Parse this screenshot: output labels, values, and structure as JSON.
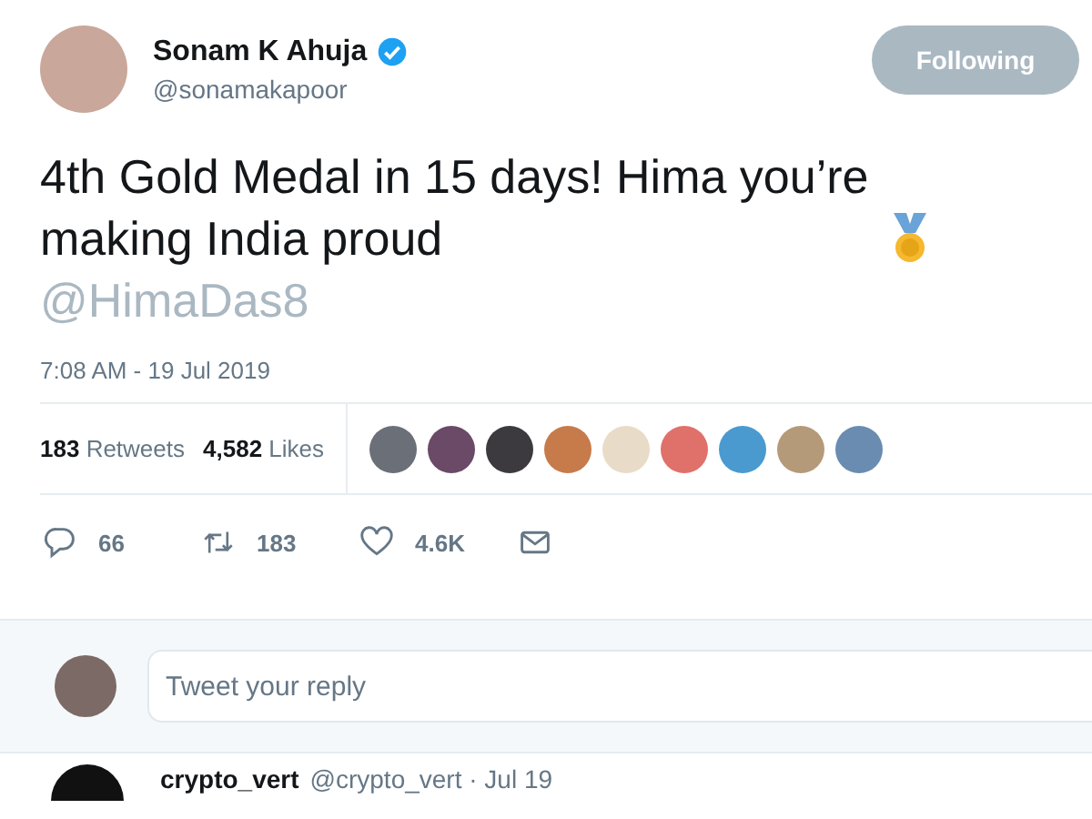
{
  "author": {
    "name": "Sonam K Ahuja",
    "verified": true,
    "handle": "@sonamakapoor"
  },
  "follow_button": {
    "label": "Following",
    "selected": true
  },
  "tweet": {
    "text": "4th Gold Medal in 15 days! Hima you’re making India proud",
    "mention": "@HimaDas8",
    "timestamp": "7:08 AM - 19 Jul 2019"
  },
  "stats": [
    {
      "count": "183",
      "label": "Retweets"
    },
    {
      "count": "4,582",
      "label": "Likes"
    }
  ],
  "liked_by": [
    {
      "color": "#6b6f78"
    },
    {
      "color": "#6a4a66"
    },
    {
      "color": "#3c3a3e"
    },
    {
      "color": "#c77a4a"
    },
    {
      "color": "#e8dcc8"
    },
    {
      "color": "#e0706a"
    },
    {
      "color": "#4a9ad0"
    },
    {
      "color": "#b59a7a"
    },
    {
      "color": "#6a8cb0"
    }
  ],
  "actions": [
    {
      "kind": "reply",
      "count": "66"
    },
    {
      "kind": "retweet",
      "count": "183"
    },
    {
      "kind": "like",
      "count": "4.6K"
    },
    {
      "kind": "message"
    }
  ],
  "reply_box": {
    "placeholder": "Tweet your reply"
  },
  "next_reply": {
    "name": "crypto_vert",
    "meta": "@crypto_vert · Jul 19"
  }
}
